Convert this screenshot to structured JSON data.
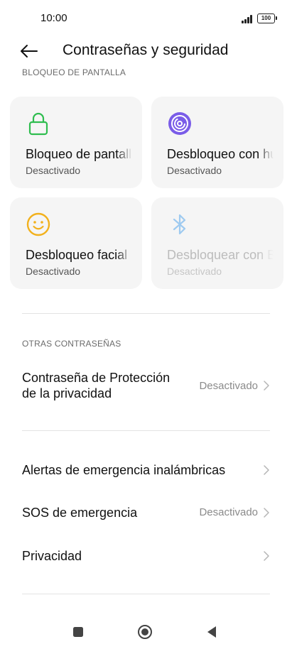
{
  "status_bar": {
    "time": "10:00",
    "battery": "100"
  },
  "header": {
    "title": "Contraseñas y seguridad"
  },
  "lock_section": {
    "label": "BLOQUEO DE PANTALLA",
    "tiles": [
      {
        "title": "Bloqueo de pantalla",
        "status": "Desactivado",
        "icon": "lock-icon",
        "color": "#2fbd4f",
        "enabled": true
      },
      {
        "title": "Desbloqueo con huella",
        "status": "Desactivado",
        "icon": "fingerprint-icon",
        "color": "#7a5ce8",
        "enabled": true
      },
      {
        "title": "Desbloqueo facial",
        "status": "Desactivado",
        "icon": "face-icon",
        "color": "#f2b11d",
        "enabled": true
      },
      {
        "title": "Desbloquear con Bluetooth",
        "status": "Desactivado",
        "icon": "bluetooth-icon",
        "color": "#9ecaf0",
        "enabled": false
      }
    ]
  },
  "other_section": {
    "label": "OTRAS CONTRASEÑAS",
    "privacy_password": {
      "label_line1": "Contraseña de Protección",
      "label_line2": "de la privacidad",
      "value": "Desactivado"
    }
  },
  "rows": {
    "emergency_alerts": {
      "label": "Alertas de emergencia inalámbricas"
    },
    "sos": {
      "label": "SOS de emergencia",
      "value": "Desactivado"
    },
    "privacy": {
      "label": "Privacidad"
    }
  },
  "nav": {
    "icons": [
      "square-icon",
      "home-circle-icon",
      "back-triangle-icon"
    ]
  }
}
